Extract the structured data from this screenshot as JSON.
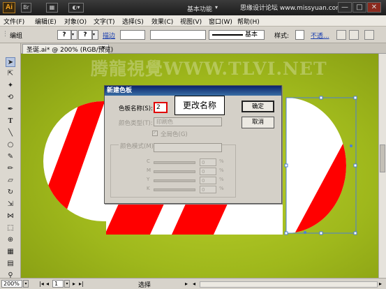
{
  "app": {
    "logo_text": "Ai",
    "toolbar_icons": [
      "Br",
      "▦",
      "◐▾"
    ],
    "workspace": "基本功能",
    "header_watermark": "思缘设计论坛 www.missyuan.com",
    "window_buttons": [
      "—",
      "□",
      "✕"
    ]
  },
  "menu": [
    "文件(F)",
    "编辑(E)",
    "对象(O)",
    "文字(T)",
    "选择(S)",
    "效果(C)",
    "视图(V)",
    "窗口(W)",
    "帮助(H)"
  ],
  "control": {
    "label": "编组",
    "fill_q": "?",
    "stroke_q": "?",
    "stroke_link": "描边",
    "stroke_style": "基本",
    "style_label": "样式:",
    "opacity_link": "不透..."
  },
  "document": {
    "tab_title": "圣诞.ai* @ 200% (RGB/预览)",
    "watermark": "腾龍視覺WWW.TLVI.NET",
    "close": "✕"
  },
  "dialog": {
    "title": "新建色板",
    "name_label": "色板名称(S):",
    "name_value": "2",
    "callout": "更改名称",
    "type_label": "颜色类型(T):",
    "type_value": "印刷色",
    "global_label": "全局色(G)",
    "mode_label": "颜色模式(M):",
    "channels": [
      "C",
      "M",
      "Y",
      "K"
    ],
    "channel_values": [
      "0",
      "0",
      "0",
      "0"
    ],
    "pct": "%",
    "ok": "确定",
    "cancel": "取消"
  },
  "status": {
    "zoom": "200%",
    "page": "1",
    "tool": "选择"
  },
  "colors": {
    "canvas": "#a6bd1e",
    "stripe_red": "#ff0000",
    "selection": "#4c7fd6"
  }
}
